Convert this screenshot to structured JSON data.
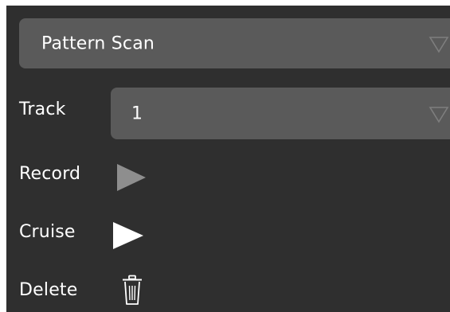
{
  "pattern": {
    "selected": "Pattern Scan",
    "caret_icon": "triangle-down-icon"
  },
  "track": {
    "label": "Track",
    "selected": "1",
    "caret_icon": "triangle-down-icon"
  },
  "actions": {
    "record": {
      "label": "Record",
      "icon": "play-icon",
      "color": "#8e8e8e"
    },
    "cruise": {
      "label": "Cruise",
      "icon": "play-icon",
      "color": "#ffffff"
    },
    "delete": {
      "label": "Delete",
      "icon": "trash-icon",
      "color": "#ffffff"
    }
  },
  "colors": {
    "panel_background": "#2f2f2f",
    "select_background": "#5a5a5a",
    "text": "#ffffff"
  }
}
